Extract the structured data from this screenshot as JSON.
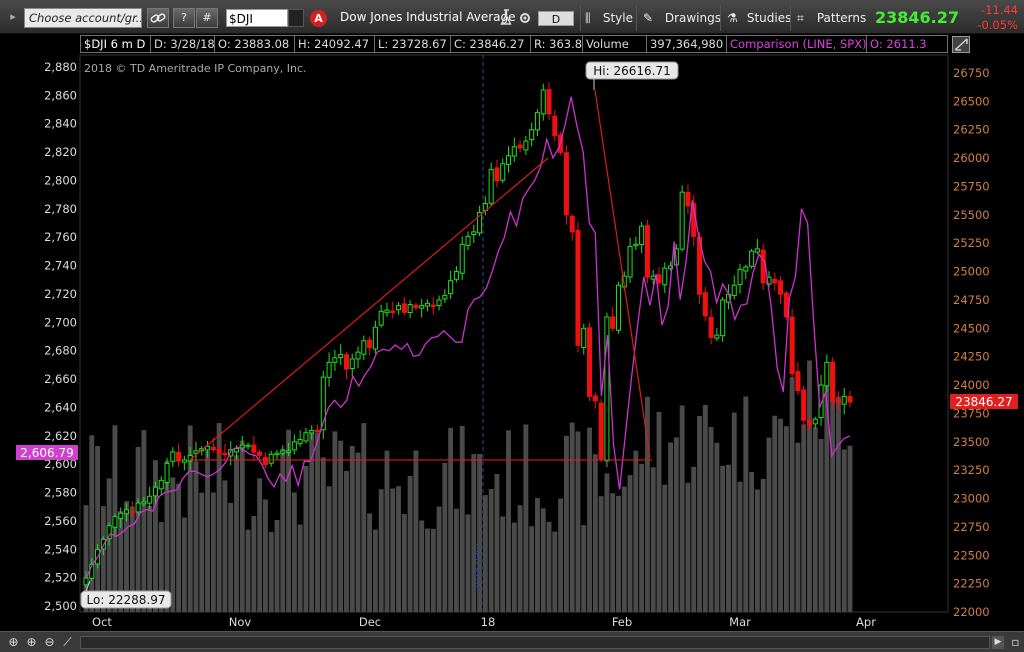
{
  "toolbar": {
    "account_placeholder": "Choose account/gr...",
    "link_icon": "link-icon",
    "help_label": "?",
    "hash_label": "#",
    "symbol": "$DJI",
    "alert_label": "A",
    "description": "Dow Jones Industrial Average",
    "period_value": "D",
    "style_label": "Style",
    "drawings_label": "Drawings",
    "studies_label": "Studies",
    "patterns_label": "Patterns",
    "last_price": "23846.27",
    "net_change": "-11.44",
    "pct_change": "-0.05%"
  },
  "infobar": {
    "symbol": "$DJI 6 m D",
    "date": "D: 3/28/18",
    "open": "O: 23883.08",
    "high": "H: 24092.47",
    "low": "L: 23728.67",
    "close": "C: 23846.27",
    "range": "R: 363.8",
    "volume_label": "Volume",
    "volume_value": "397,364,980",
    "comparison": "Comparison (LINE, SPX)",
    "comp_open": "O: 2611.3"
  },
  "chart_data": {
    "type": "candlestick",
    "copyright": "2018 © TD Ameritrade IP Company, Inc.",
    "x_labels": [
      "Oct",
      "Nov",
      "Dec",
      "18",
      "Feb",
      "Mar",
      "Apr"
    ],
    "left_axis": {
      "min": 2500,
      "max": 2880,
      "step": 20,
      "label": "SPX"
    },
    "right_axis": {
      "min": 22000,
      "max": 26750,
      "step": 250,
      "label": "$DJI"
    },
    "hi_label": "Hi: 26616.71",
    "lo_label": "Lo: 22288.97",
    "last_price_label": "23846.27",
    "comparison_label": "2,606.79",
    "year_marker": "2018 (Jan)",
    "dji_close": [
      22300,
      22420,
      22550,
      22640,
      22760,
      22840,
      22870,
      22900,
      22880,
      22960,
      22970,
      23020,
      23100,
      23160,
      23310,
      23410,
      23330,
      23340,
      23380,
      23420,
      23440,
      23460,
      23430,
      23400,
      23390,
      23430,
      23440,
      23470,
      23470,
      23410,
      23380,
      23300,
      23390,
      23400,
      23420,
      23420,
      23500,
      23520,
      23580,
      23600,
      23600,
      24070,
      24200,
      24240,
      24270,
      24140,
      24230,
      24290,
      24390,
      24330,
      24510,
      24650,
      24660,
      24650,
      24700,
      24640,
      24710,
      24680,
      24700,
      24720,
      24700,
      24750,
      24790,
      24920,
      25000,
      25240,
      25310,
      25350,
      25520,
      25600,
      25900,
      25800,
      25950,
      26020,
      26100,
      26090,
      26150,
      26250,
      26400,
      26600,
      26390,
      26200,
      26050,
      25500,
      25350,
      24350,
      24500,
      23900,
      23860,
      23350,
      24600,
      24500,
      24880,
      24960,
      25220,
      25240,
      25400,
      24950,
      24960,
      24900,
      25030,
      25050,
      25200,
      25700,
      25580,
      25310,
      24800,
      24610,
      24420,
      24440,
      24750,
      24800,
      24880,
      25020,
      25040,
      25180,
      25200,
      24900,
      24950,
      24900,
      24800,
      24600,
      24100,
      23950,
      23690,
      23640,
      23700,
      24000,
      24200,
      23860,
      23850,
      23900,
      23850
    ],
    "spx_close": [
      2519,
      2529,
      2535,
      2544,
      2551,
      2549,
      2552,
      2556,
      2558,
      2566,
      2568,
      2567,
      2577,
      2580,
      2581,
      2582,
      2590,
      2595,
      2595,
      2593,
      2591,
      2593,
      2596,
      2601,
      2610,
      2612,
      2610,
      2607,
      2606,
      2600,
      2590,
      2584,
      2593,
      2588,
      2599,
      2585,
      2602,
      2602,
      2614,
      2628,
      2640,
      2645,
      2640,
      2645,
      2662,
      2655,
      2663,
      2669,
      2679,
      2681,
      2680,
      2684,
      2681,
      2685,
      2676,
      2677,
      2685,
      2689,
      2690,
      2694,
      2690,
      2686,
      2686,
      2709,
      2716,
      2718,
      2724,
      2736,
      2750,
      2760,
      2778,
      2768,
      2787,
      2794,
      2800,
      2810,
      2829,
      2816,
      2823,
      2839,
      2859,
      2838,
      2820,
      2770,
      2763,
      2648,
      2691,
      2614,
      2582,
      2623,
      2662,
      2699,
      2732,
      2712,
      2734,
      2698,
      2711,
      2757,
      2716,
      2744,
      2786,
      2762,
      2743,
      2736,
      2714,
      2727,
      2720,
      2702,
      2712,
      2713,
      2735,
      2748,
      2742,
      2711,
      2668,
      2651,
      2717,
      2732,
      2780,
      2770,
      2701,
      2640,
      2651,
      2606,
      2613,
      2618,
      2620
    ]
  },
  "colors": {
    "up": "#22dd22",
    "down": "#ee1111",
    "comparison": "#cc33cc",
    "volume": "#4a4a4a",
    "trend": "#dd1a1a",
    "axis_text": "#d08040",
    "left_axis_text": "#dddddd"
  },
  "bottombar": {
    "zoom_in": "zoom-in-icon",
    "zoom_out": "zoom-out-icon",
    "pan": "pan-icon"
  }
}
